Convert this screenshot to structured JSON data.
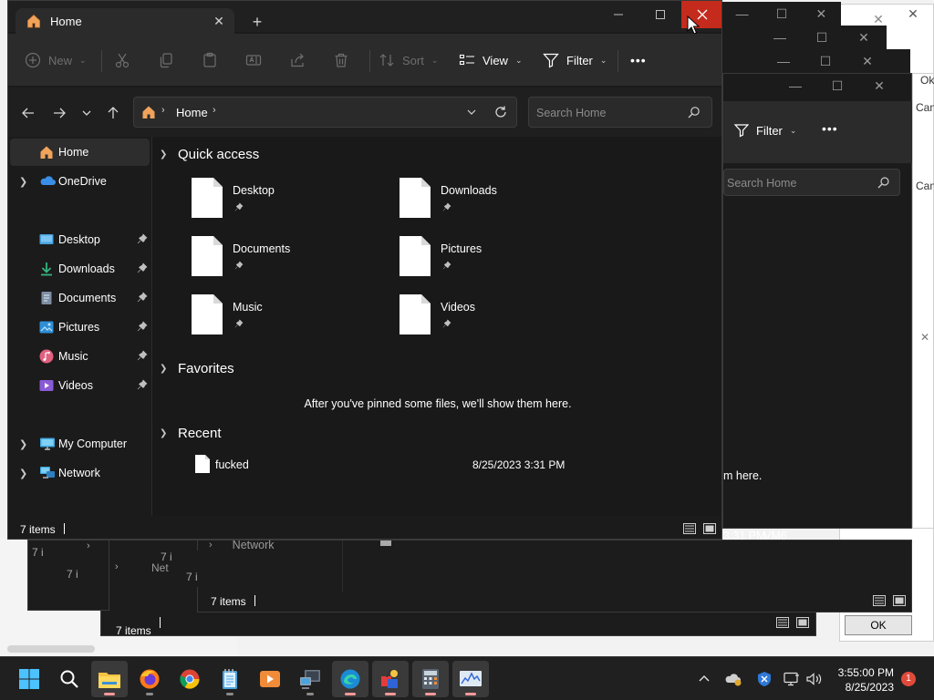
{
  "window": {
    "tab_title": "Home",
    "icons": {
      "tab": "home-icon",
      "tab_close": "close-icon",
      "new_tab": "plus-icon",
      "minimize": "minimize-icon",
      "maximize": "maximize-icon",
      "close": "close-icon"
    }
  },
  "toolbar": {
    "new_label": "New",
    "sort_label": "Sort",
    "view_label": "View",
    "filter_label": "Filter",
    "more_label": "•••",
    "icons": [
      "plus-circle-icon",
      "cut-icon",
      "copy-icon",
      "paste-icon",
      "rename-icon",
      "share-icon",
      "delete-icon",
      "sort-icon",
      "view-icon",
      "filter-icon",
      "more-icon"
    ]
  },
  "nav": {
    "address_label": "Home",
    "search_placeholder": "Search Home",
    "icons": [
      "back-arrow-icon",
      "forward-arrow-icon",
      "history-chevron-icon",
      "up-arrow-icon",
      "refresh-icon",
      "search-icon"
    ]
  },
  "sidebar": {
    "home": "Home",
    "onedrive": "OneDrive",
    "desktop": "Desktop",
    "downloads": "Downloads",
    "documents": "Documents",
    "pictures": "Pictures",
    "music": "Music",
    "videos": "Videos",
    "my_computer": "My Computer",
    "network": "Network"
  },
  "main": {
    "quick_access_title": "Quick access",
    "quick_access": [
      {
        "name": "Desktop"
      },
      {
        "name": "Downloads"
      },
      {
        "name": "Documents"
      },
      {
        "name": "Pictures"
      },
      {
        "name": "Music"
      },
      {
        "name": "Videos"
      }
    ],
    "favorites_title": "Favorites",
    "favorites_empty": "After you've pinned some files, we'll show them here.",
    "recent_title": "Recent",
    "recent": [
      {
        "name": "fucked",
        "date": "8/25/2023 3:31 PM"
      }
    ]
  },
  "status": {
    "count": "7 items"
  },
  "background": {
    "filter_label": "Filter",
    "search_placeholder": "Search Home",
    "them_here": "m here.",
    "time_fragment": "3:31 PM",
    "vm_label": "VM6",
    "network_label": "Network",
    "net_fragment": "Net",
    "count_1": "7 items",
    "count_2": "7 items",
    "ok_label": "OK",
    "ok_fragment": "Ok",
    "cancel_fragment": "Can",
    "seven_i": "7 i"
  },
  "taskbar": {
    "apps": [
      "windows-start-icon",
      "search-icon",
      "file-explorer-icon",
      "firefox-icon",
      "chrome-icon",
      "notepad-icon",
      "media-player-icon",
      "remote-desktop-icon",
      "edge-icon",
      "paint-icon",
      "calculator-icon",
      "resource-monitor-icon"
    ],
    "tray_icons": [
      "chevron-up-icon",
      "onedrive-status-icon",
      "security-icon",
      "network-icon",
      "volume-icon"
    ],
    "time": "3:55:00 PM",
    "date": "8/25/2023",
    "notification_count": "1"
  },
  "colors": {
    "close_hover": "#c42b1c",
    "window_bg": "#1b1b1b",
    "toolbar_bg": "#2b2b2b",
    "taskbar_bg": "#202020",
    "folder_home": "#f0a35a",
    "onedrive_blue": "#3a8ee6"
  }
}
